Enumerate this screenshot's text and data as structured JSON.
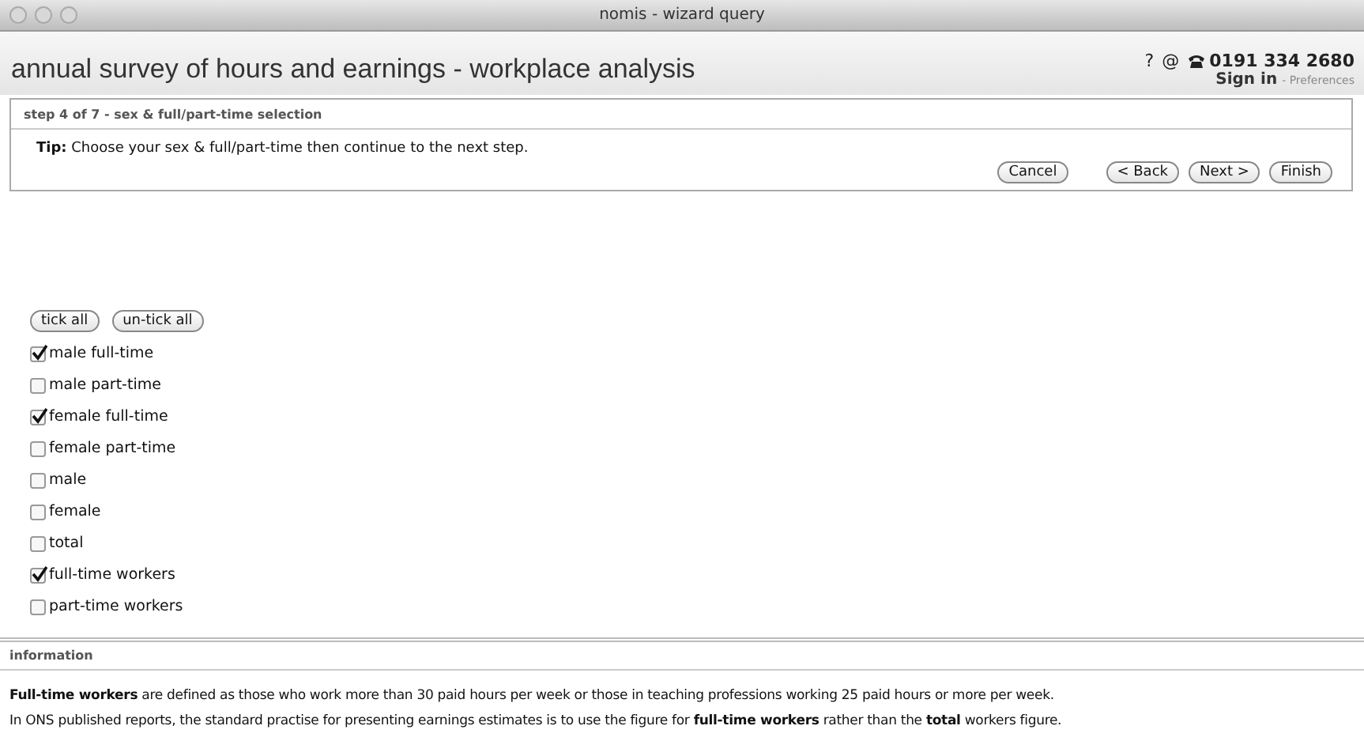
{
  "window": {
    "title": "nomis - wizard query"
  },
  "header": {
    "title": "annual survey of hours and earnings - workplace analysis",
    "help": "?",
    "email": "@",
    "phone": "0191 334 2680",
    "sign_in": "Sign in",
    "preferences": "- Preferences"
  },
  "step": {
    "heading": "step 4 of 7 - sex & full/part-time selection",
    "tip": "**Tip:** Choose your sex & full/part-time then continue to the next step.",
    "buttons": [
      "Cancel",
      "< Back",
      "Next >",
      "Finish"
    ]
  },
  "select_buttons": [
    "tick all",
    "un-tick all"
  ],
  "options": [
    {
      "label": "male full-time",
      "checked": true
    },
    {
      "label": "male part-time",
      "checked": false
    },
    {
      "label": "female full-time",
      "checked": true
    },
    {
      "label": "female part-time",
      "checked": false
    },
    {
      "label": "male",
      "checked": false
    },
    {
      "label": "female",
      "checked": false
    },
    {
      "label": "total",
      "checked": false
    },
    {
      "label": "full-time workers",
      "checked": true
    },
    {
      "label": "part-time workers",
      "checked": false
    }
  ],
  "information": {
    "heading": "information",
    "paragraphs": [
      "**Full-time workers** are defined as those who work more than 30 paid hours per week or those in teaching professions working 25 paid hours or more per week.",
      "In ONS published reports, the standard practise for presenting earnings estimates is to use the figure for **full-time workers** rather than the **total** workers figure."
    ]
  }
}
